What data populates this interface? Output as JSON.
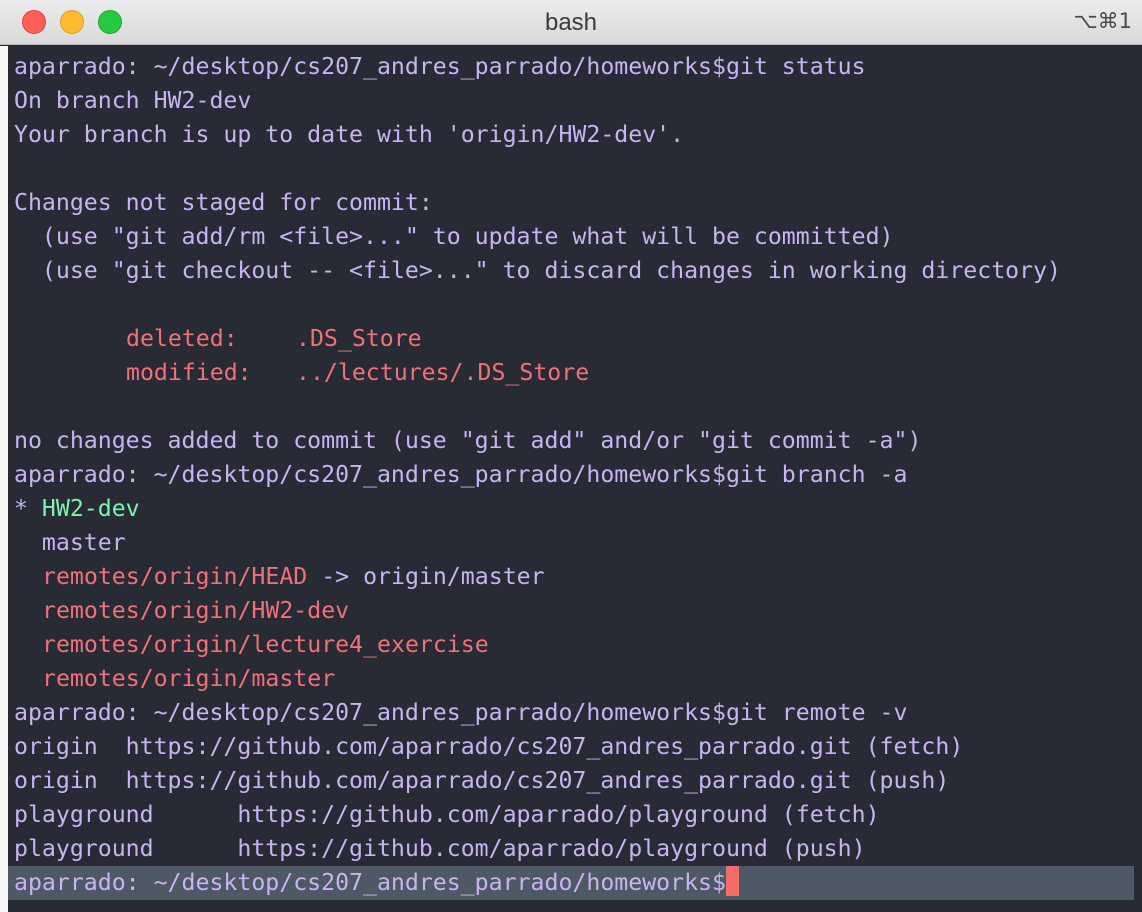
{
  "window": {
    "title": "bash",
    "shortcut": "⌥⌘1"
  },
  "terminal": {
    "l1_prompt": "aparrado: ~/desktop/cs207_andres_parrado/homeworks$",
    "l1_cmd": "git status",
    "l2": "On branch HW2-dev",
    "l3": "Your branch is up to date with 'origin/HW2-dev'.",
    "l5": "Changes not staged for commit:",
    "l6": "  (use \"git add/rm <file>...\" to update what will be committed)",
    "l7": "  (use \"git checkout -- <file>...\" to discard changes in working directory)",
    "l9_status": "deleted:",
    "l9_file": ".DS_Store",
    "l10_status": "modified:",
    "l10_file": "../lectures/.DS_Store",
    "l12": "no changes added to commit (use \"git add\" and/or \"git commit -a\")",
    "l13_prompt": "aparrado: ~/desktop/cs207_andres_parrado/homeworks$",
    "l13_cmd": "git branch -a",
    "l14_star": "* ",
    "l14_branch": "HW2-dev",
    "l15": "  master",
    "l16_ref": "remotes/origin/HEAD",
    "l16_arrow": " -> origin/master",
    "l17": "remotes/origin/HW2-dev",
    "l18": "remotes/origin/lecture4_exercise",
    "l19": "remotes/origin/master",
    "l20_prompt": "aparrado: ~/desktop/cs207_andres_parrado/homeworks$",
    "l20_cmd": "git remote -v",
    "l21": "origin  https://github.com/aparrado/cs207_andres_parrado.git (fetch)",
    "l22": "origin  https://github.com/aparrado/cs207_andres_parrado.git (push)",
    "l23": "playground      https://github.com/aparrado/playground (fetch)",
    "l24": "playground      https://github.com/aparrado/playground (push)",
    "l25_prompt": "aparrado: ~/desktop/cs207_andres_parrado/homeworks$"
  },
  "colors": {
    "background": "#282b36",
    "text": "#c8b4f0",
    "red": "#f07178",
    "green": "#7ef2b0",
    "cursor": "#f36b6b",
    "prompt_highlight": "#4d5a66"
  }
}
